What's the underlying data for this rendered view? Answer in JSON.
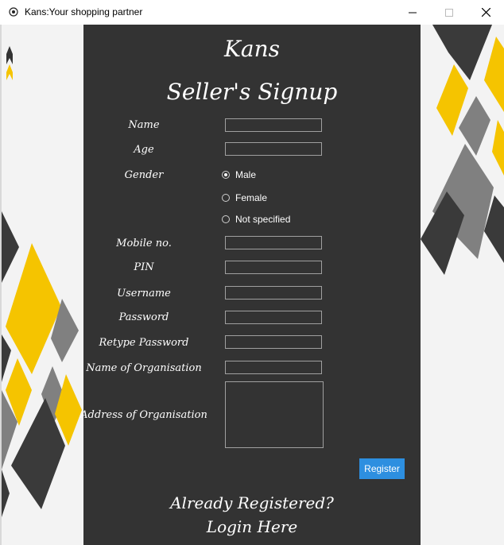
{
  "window": {
    "title": "Kans:Your shopping partner",
    "controls": [
      "minimize-icon",
      "maximize-icon",
      "close-icon"
    ]
  },
  "brand": "Kans",
  "page_title": "Seller's Signup",
  "form": {
    "name_label": "Name",
    "name_value": "",
    "age_label": "Age",
    "age_value": "",
    "gender_label": "Gender",
    "gender_options": [
      "Male",
      "Female",
      "Not specified"
    ],
    "gender_selected": "Male",
    "mobile_label": "Mobile no.",
    "mobile_value": "",
    "pin_label": "PIN",
    "pin_value": "",
    "username_label": "Username",
    "username_value": "",
    "password_label": "Password",
    "password_value": "",
    "retype_label": "Retype Password",
    "retype_value": "",
    "org_name_label": "Name of Organisation",
    "org_name_value": "",
    "org_address_label": "Address of Organisation",
    "org_address_value": ""
  },
  "register_button": "Register",
  "login_link": {
    "line1": "Already Registered?",
    "line2": "Login Here"
  },
  "colors": {
    "panel_bg": "#333333",
    "accent_yellow": "#f5c400",
    "deco_dark": "#3a3a3a",
    "deco_gray": "#808080",
    "button_blue": "#2d8fe0"
  }
}
